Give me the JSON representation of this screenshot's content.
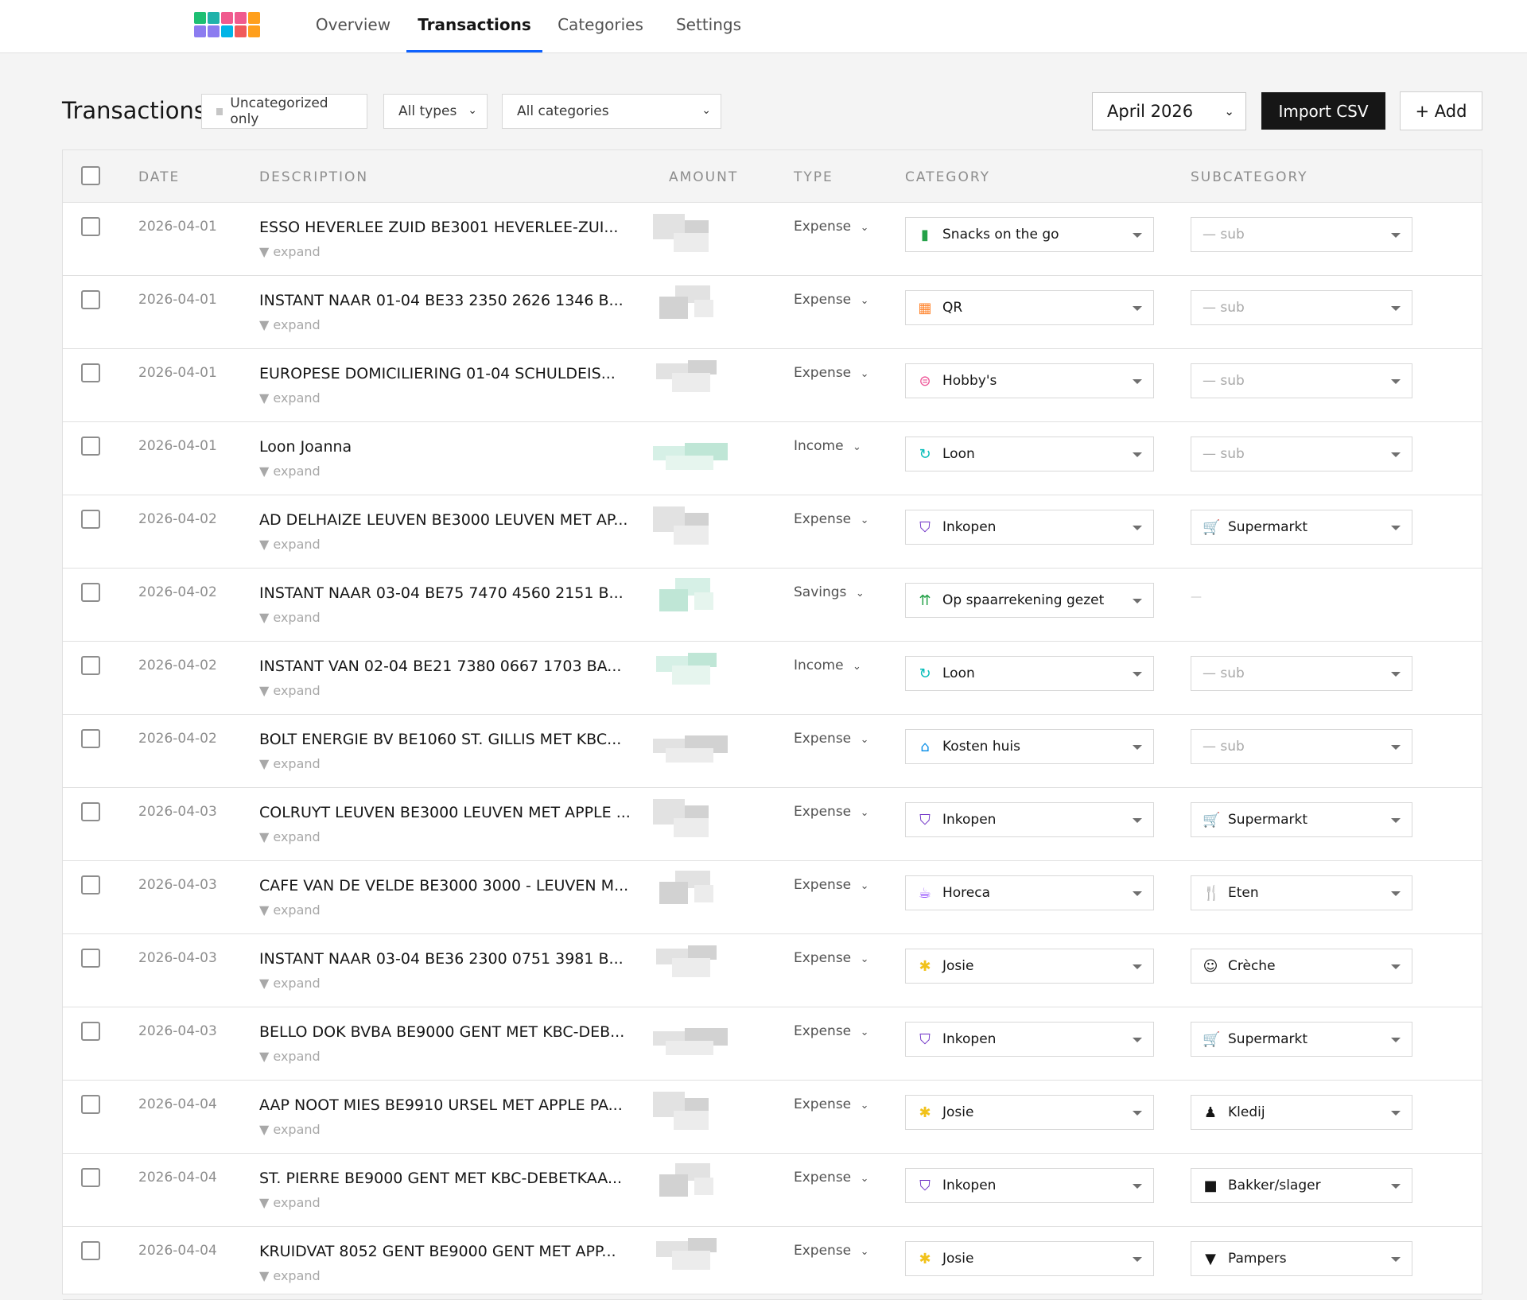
{
  "nav": {
    "tabs": [
      {
        "label": "Overview",
        "active": false
      },
      {
        "label": "Transactions",
        "active": true
      },
      {
        "label": "Categories",
        "active": false
      },
      {
        "label": "Settings",
        "active": false
      }
    ],
    "logo_colors": [
      "#1dbf73",
      "#20b2aa",
      "#f05a8e",
      "#f05a8e",
      "#ff9f1c",
      "#8c7cf0",
      "#8c7cf0",
      "#00b4e6",
      "#f05a5a",
      "#ff9f1c"
    ]
  },
  "toolbar": {
    "title": "Transactions",
    "uncategorized_label": "Uncategorized only",
    "types_select": "All types",
    "categories_select": "All categories",
    "month_select": "April 2026",
    "import_label": "Import CSV",
    "add_label": "+ Add"
  },
  "table": {
    "headers": {
      "date": "DATE",
      "description": "DESCRIPTION",
      "amount": "AMOUNT",
      "type": "TYPE",
      "category": "CATEGORY",
      "subcategory": "SUBCATEGORY"
    },
    "expand_label": "▼ expand",
    "sub_placeholder": "— sub",
    "rows": [
      {
        "date": "2026-04-01",
        "description": "ESSO HEVERLEE ZUID BE3001 HEVERLEE-ZUI...",
        "type": "Expense",
        "category": "Snacks on the go",
        "category_icon": "battery-icon",
        "category_icon_glyph": "▮",
        "category_icon_color": "#24a148",
        "subcategory": null,
        "sub_icon": null,
        "sub_icon_glyph": "",
        "amount_tone": "neutral"
      },
      {
        "date": "2026-04-01",
        "description": "INSTANT NAAR 01-04 BE33 2350 2626 1346 B...",
        "type": "Expense",
        "category": "QR",
        "category_icon": "qr-code-icon",
        "category_icon_glyph": "▦",
        "category_icon_color": "#ff832b",
        "subcategory": null,
        "sub_icon": null,
        "sub_icon_glyph": "",
        "amount_tone": "neutral"
      },
      {
        "date": "2026-04-01",
        "description": "EUROPESE DOMICILIERING 01-04 SCHULDEIS...",
        "type": "Expense",
        "category": "Hobby's",
        "category_icon": "yarn-icon",
        "category_icon_glyph": "⊜",
        "category_icon_color": "#ee5396",
        "subcategory": null,
        "sub_icon": null,
        "sub_icon_glyph": "",
        "amount_tone": "neutral"
      },
      {
        "date": "2026-04-01",
        "description": "Loon Joanna",
        "type": "Income",
        "category": "Loon",
        "category_icon": "refresh-icon",
        "category_icon_glyph": "↻",
        "category_icon_color": "#08bdba",
        "subcategory": null,
        "sub_icon": null,
        "sub_icon_glyph": "",
        "amount_tone": "green"
      },
      {
        "date": "2026-04-02",
        "description": "AD DELHAIZE LEUVEN BE3000 LEUVEN MET AP...",
        "type": "Expense",
        "category": "Inkopen",
        "category_icon": "basket-icon",
        "category_icon_glyph": "⛉",
        "category_icon_color": "#6929c4",
        "subcategory": "Supermarkt",
        "sub_icon": "cart-icon",
        "sub_icon_glyph": "🛒",
        "amount_tone": "neutral"
      },
      {
        "date": "2026-04-02",
        "description": "INSTANT NAAR 03-04 BE75 7470 4560 2151 B...",
        "type": "Savings",
        "category": "Op spaarrekening gezet",
        "category_icon": "double-chevron-up-icon",
        "category_icon_glyph": "⇈",
        "category_icon_color": "#24a148",
        "subcategory": "—",
        "sub_icon": "none",
        "sub_icon_glyph": "",
        "amount_tone": "green"
      },
      {
        "date": "2026-04-02",
        "description": "INSTANT VAN 02-04 BE21 7380 0667 1703 BA...",
        "type": "Income",
        "category": "Loon",
        "category_icon": "refresh-icon",
        "category_icon_glyph": "↻",
        "category_icon_color": "#08bdba",
        "subcategory": null,
        "sub_icon": null,
        "sub_icon_glyph": "",
        "amount_tone": "green"
      },
      {
        "date": "2026-04-02",
        "description": "BOLT ENERGIE BV BE1060 ST. GILLIS MET KBC...",
        "type": "Expense",
        "category": "Kosten huis",
        "category_icon": "house-icon",
        "category_icon_glyph": "⌂",
        "category_icon_color": "#1192e8",
        "subcategory": null,
        "sub_icon": null,
        "sub_icon_glyph": "",
        "amount_tone": "neutral"
      },
      {
        "date": "2026-04-03",
        "description": "COLRUYT LEUVEN BE3000 LEUVEN MET APPLE ...",
        "type": "Expense",
        "category": "Inkopen",
        "category_icon": "basket-icon",
        "category_icon_glyph": "⛉",
        "category_icon_color": "#6929c4",
        "subcategory": "Supermarkt",
        "sub_icon": "cart-icon",
        "sub_icon_glyph": "🛒",
        "amount_tone": "neutral"
      },
      {
        "date": "2026-04-03",
        "description": "CAFE VAN DE VELDE BE3000 3000 - LEUVEN M...",
        "type": "Expense",
        "category": "Horeca",
        "category_icon": "cup-icon",
        "category_icon_glyph": "☕",
        "category_icon_color": "#8a3ffc",
        "subcategory": "Eten",
        "sub_icon": "fork-knife-icon",
        "sub_icon_glyph": "🍴",
        "amount_tone": "neutral"
      },
      {
        "date": "2026-04-03",
        "description": "INSTANT NAAR 03-04 BE36 2300 0751 3981 B...",
        "type": "Expense",
        "category": "Josie",
        "category_icon": "child-icon",
        "category_icon_glyph": "✱",
        "category_icon_color": "#f1c21b",
        "subcategory": "Crèche",
        "sub_icon": "baby-icon",
        "sub_icon_glyph": "☺",
        "amount_tone": "neutral"
      },
      {
        "date": "2026-04-03",
        "description": "BELLO DOK BVBA BE9000 GENT MET KBC-DEB...",
        "type": "Expense",
        "category": "Inkopen",
        "category_icon": "basket-icon",
        "category_icon_glyph": "⛉",
        "category_icon_color": "#6929c4",
        "subcategory": "Supermarkt",
        "sub_icon": "cart-icon",
        "sub_icon_glyph": "🛒",
        "amount_tone": "neutral"
      },
      {
        "date": "2026-04-04",
        "description": "AAP NOOT MIES BE9910 URSEL MET APPLE PA...",
        "type": "Expense",
        "category": "Josie",
        "category_icon": "child-icon",
        "category_icon_glyph": "✱",
        "category_icon_color": "#f1c21b",
        "subcategory": "Kledij",
        "sub_icon": "dress-icon",
        "sub_icon_glyph": "♟",
        "amount_tone": "neutral"
      },
      {
        "date": "2026-04-04",
        "description": "ST. PIERRE BE9000 GENT MET KBC-DEBETKAA...",
        "type": "Expense",
        "category": "Inkopen",
        "category_icon": "basket-icon",
        "category_icon_glyph": "⛉",
        "category_icon_color": "#6929c4",
        "subcategory": "Bakker/slager",
        "sub_icon": "bread-icon",
        "sub_icon_glyph": "■",
        "amount_tone": "neutral"
      },
      {
        "date": "2026-04-04",
        "description": "KRUIDVAT 8052 GENT BE9000 GENT MET APP...",
        "type": "Expense",
        "category": "Josie",
        "category_icon": "child-icon",
        "category_icon_glyph": "✱",
        "category_icon_color": "#f1c21b",
        "subcategory": "Pampers",
        "sub_icon": "diaper-icon",
        "sub_icon_glyph": "▼",
        "amount_tone": "neutral"
      }
    ]
  }
}
